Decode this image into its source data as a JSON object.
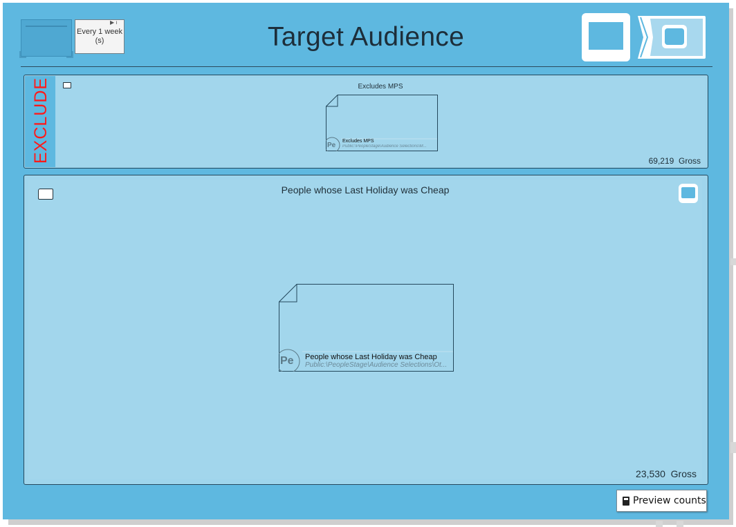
{
  "header": {
    "title": "Target Audience",
    "schedule_label": "Every 1 week (s)"
  },
  "colors": {
    "panel": "#5eb8e0",
    "section_fill": "#a2d6ec",
    "exclude_text": "#ff1a1a",
    "border": "#24485c"
  },
  "icons": {
    "schedule_play": "play-icon",
    "view_toggle_full": "full-view-icon",
    "view_toggle_nested": "nested-view-icon",
    "section_tag": "tag-icon",
    "preview": "calculator-icon"
  },
  "exclude_section": {
    "label": "EXCLUDE",
    "title": "Excludes MPS",
    "card": {
      "badge": "Pe",
      "name": "Excludes MPS",
      "path": "Public:\\PeopleStage\\Audience Selections\\M..."
    },
    "count": "69,219",
    "count_suffix": "Gross"
  },
  "main_section": {
    "title": "People whose Last Holiday was Cheap",
    "card": {
      "badge": "Pe",
      "name": "People whose Last Holiday was Cheap",
      "path": "Public:\\PeopleStage\\Audience Selections\\Ot..."
    },
    "count": "23,530",
    "count_suffix": "Gross"
  },
  "footer": {
    "preview_label": "Preview counts"
  }
}
